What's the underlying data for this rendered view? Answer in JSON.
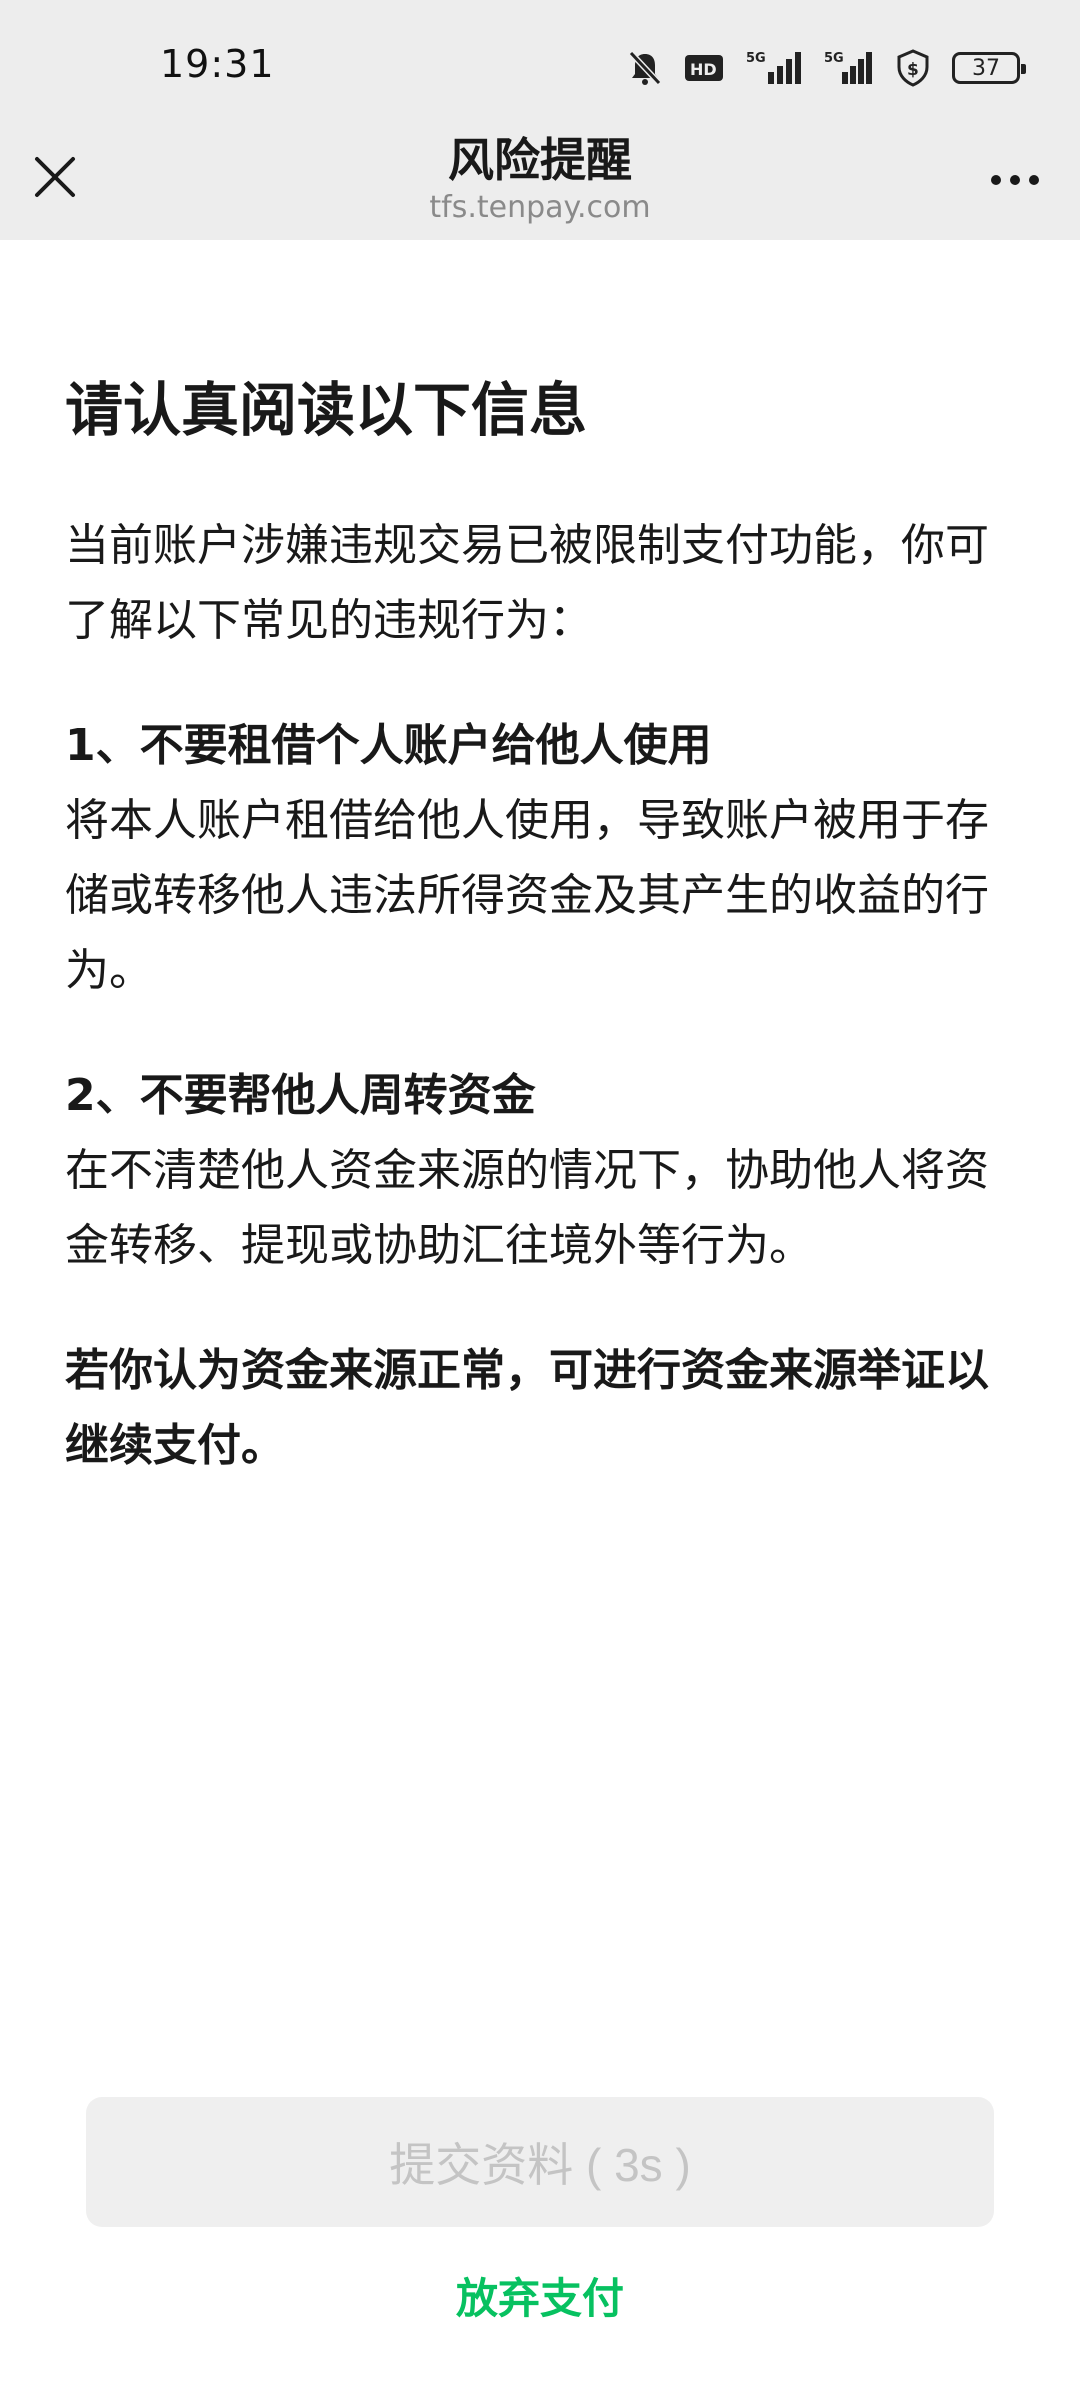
{
  "status_bar": {
    "time": "19:31",
    "icons": [
      "bell-muted-icon",
      "hd-icon",
      "signal-5g-icon",
      "signal-5g-icon",
      "shield-dollar-icon"
    ],
    "battery": "37"
  },
  "nav": {
    "title": "风险提醒",
    "subtitle": "tfs.tenpay.com",
    "close_icon": "close-icon",
    "more_icon": "more-icon"
  },
  "content": {
    "heading": "请认真阅读以下信息",
    "intro": "当前账户涉嫌违规交易已被限制支付功能，你可了解以下常见的违规行为：",
    "sections": [
      {
        "title": "1、不要租借个人账户给他人使用",
        "body": "将本人账户租借给他人使用，导致账户被用于存储或转移他人违法所得资金及其产生的收益的行为。"
      },
      {
        "title": "2、不要帮他人周转资金",
        "body": "在不清楚他人资金来源的情况下，协助他人将资金转移、提现或协助汇往境外等行为。"
      }
    ],
    "note": "若你认为资金来源正常，可进行资金来源举证以继续支付。"
  },
  "actions": {
    "submit_label": "提交资料 ( 3s )",
    "abandon_label": "放弃支付"
  },
  "colors": {
    "header_bg": "#ededed",
    "accent_green": "#07c160",
    "disabled_bg": "#efefef",
    "disabled_text": "#c4c4c4"
  }
}
